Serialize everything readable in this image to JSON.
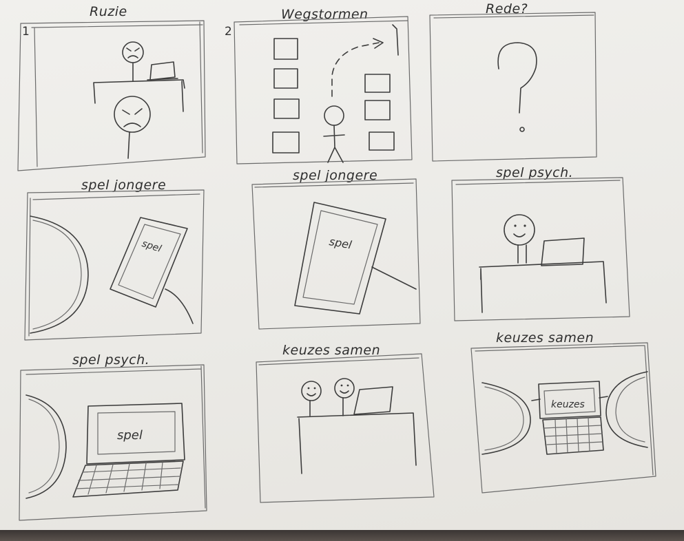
{
  "panels": [
    {
      "number": "1",
      "title": "Ruzie"
    },
    {
      "number": "2",
      "title": "Wegstormen"
    },
    {
      "number": "",
      "title": "Rede?"
    },
    {
      "number": "",
      "title": "spel jongere"
    },
    {
      "number": "",
      "title": "spel jongere"
    },
    {
      "number": "",
      "title": "spel psych."
    },
    {
      "number": "",
      "title": "spel psych."
    },
    {
      "number": "",
      "title": "keuzes samen"
    },
    {
      "number": "",
      "title": "keuzes samen"
    }
  ],
  "inner_labels": {
    "panel4_screen": "spel",
    "panel5_screen": "spel",
    "panel7_screen": "spel",
    "panel9_screen": "keuzes"
  },
  "colors": {
    "paper": "#ecebe7",
    "pencil": "#3c3c3c",
    "background": "#4a4542"
  }
}
